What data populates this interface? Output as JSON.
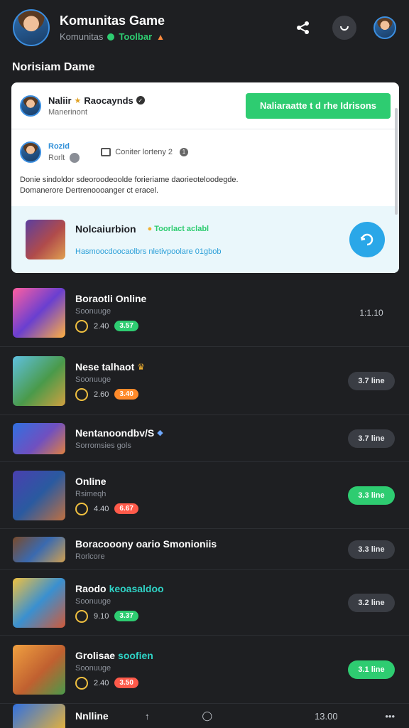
{
  "header": {
    "title": "Komunitas Game",
    "subtitle": "Komunitas",
    "status": "Toolbar",
    "user_avatar": "avatar",
    "icons": [
      "share-icon",
      "refresh-icon",
      "profile-avatar"
    ]
  },
  "section_title": "Norisiam Dame",
  "card": {
    "user_name": "Naliir",
    "user_tag": "Raocaynds",
    "user_sub": "Manerinont",
    "join_label": "Naliaraatte t d rhe Idrisons",
    "user2_name": "Rozid",
    "user2_sub": "Rorlt",
    "meta_text": "Coniter lorteny 2",
    "meta_count": "1",
    "description_line1": "Donie sindoldor sdeoroodeoolde forieriame daorieoteloodegde.",
    "description_line2": "Domanerore Dertrenoooanger ct eracel.",
    "promo_title": "Nolcaiurbion",
    "promo_tag": "Toorlact aclabl",
    "promo_sub": "Hasmoocdoocaolbrs nletivpoolare 01gbob"
  },
  "list": [
    {
      "title": "Boraotli Online",
      "sub": "Soonuuge",
      "meta": "2.40",
      "pill": "3.57",
      "pill_color": "#2ecc71",
      "right": "1:1.10",
      "right_style": "plain",
      "thumb": "linear-gradient(135deg,#ff5fa0,#6a3fd0 50%,#ffb040)",
      "h": 96
    },
    {
      "title": "Nese talhaot",
      "title_icon": "crown",
      "sub": "Soonuuge",
      "meta": "2.60",
      "pill": "3.40",
      "pill_color": "#ff8a2a",
      "right": "3.7 line",
      "right_style": "grey",
      "thumb": "linear-gradient(135deg,#5fc0e0,#4a9a4a 55%,#d0a040)",
      "h": 96
    },
    {
      "title": "Nentanoondbv/S",
      "title_icon": "shield",
      "sub": "Sorromsies gols",
      "meta": "",
      "pill": "",
      "pill_color": "",
      "right": "3.7 line",
      "right_style": "grey",
      "thumb": "linear-gradient(135deg,#3070e0,#7050c0 55%,#e08040)",
      "h": 66
    },
    {
      "title": "Online",
      "sub": "Rsimeqh",
      "meta": "4.40",
      "pill": "6.67",
      "pill_color": "#ff5a4a",
      "right": "3.3 line",
      "right_style": "green",
      "thumb": "linear-gradient(135deg,#4a3fb0,#2a5aa0 50%,#c07040)",
      "h": 94
    },
    {
      "title": "Boracooony oario Smonioniis",
      "sub": "Rorlcore",
      "meta": "",
      "pill": "",
      "pill_color": "",
      "right": "3.3 line",
      "right_style": "grey",
      "thumb": "linear-gradient(135deg,#7a4a2a,#3a6ab0 50%,#d0a050)",
      "h": 58
    },
    {
      "title": "Raodo",
      "title_accent": "keoasaldoo",
      "sub": "Soonuuge",
      "meta": "9.10",
      "pill": "3.37",
      "pill_color": "#2ecc71",
      "right": "3.2 line",
      "right_style": "grey",
      "thumb": "linear-gradient(135deg,#f0c040,#3a90d0 50%,#d05a3a)",
      "h": 92
    },
    {
      "title": "Grolisae",
      "title_accent": "soofien",
      "sub": "Soonuuge",
      "meta": "2.40",
      "pill": "3.50",
      "pill_color": "#ff5a4a",
      "right": "3.1 line",
      "right_style": "green",
      "thumb": "linear-gradient(135deg,#f0a040,#c06030 55%,#4a9a4a)",
      "h": 96
    }
  ],
  "bottom": {
    "title": "Nnlline",
    "count": "13.00",
    "icons": [
      "up-icon",
      "chat-icon",
      "more-icon"
    ]
  }
}
